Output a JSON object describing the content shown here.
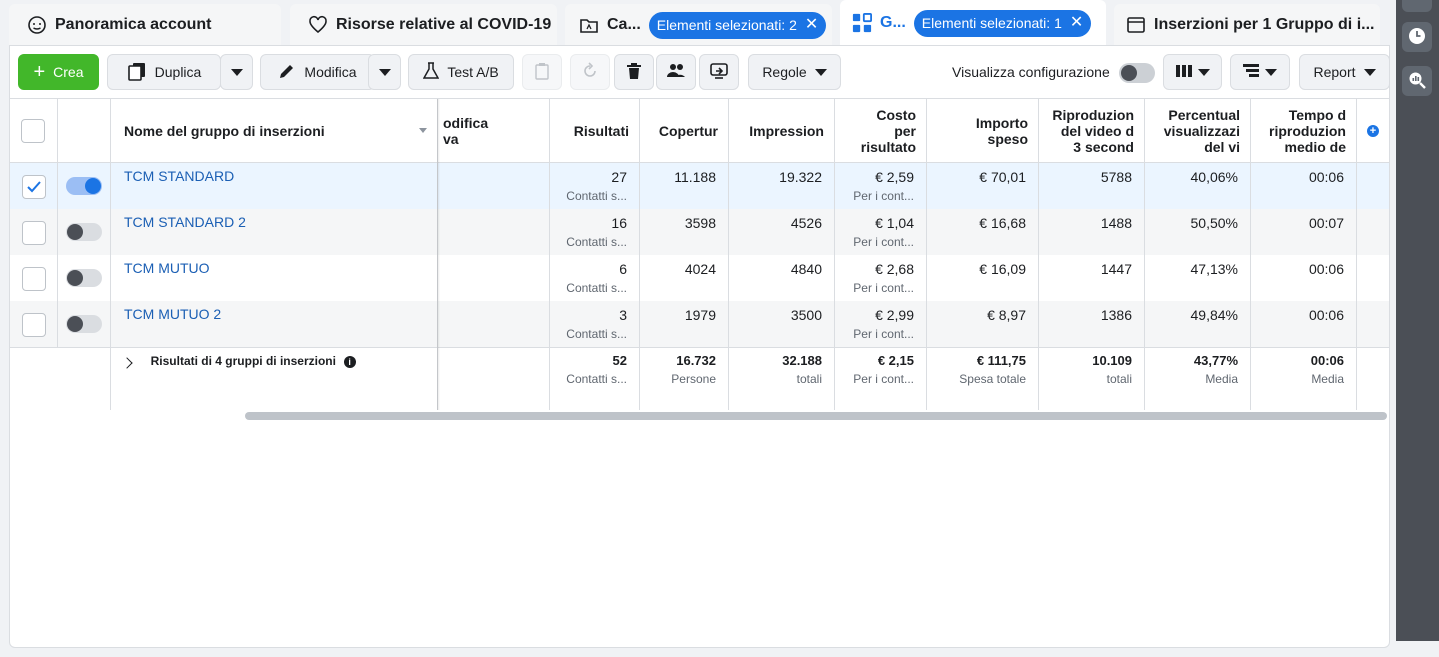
{
  "tabs": [
    {
      "label": "Panoramica account",
      "icon": "gauge-icon"
    },
    {
      "label": "Risorse relative al COVID-19",
      "icon": "heart-icon"
    },
    {
      "label": "Ca...",
      "icon": "folder-icon",
      "pill": "Elementi selezionati: 2"
    },
    {
      "label": "G...",
      "icon": "grid-icon",
      "pill": "Elementi selezionati: 1"
    },
    {
      "label": "Inserzioni per 1 Gruppo di i...",
      "icon": "window-icon"
    }
  ],
  "toolbar": {
    "create_label": "Crea",
    "duplicate_label": "Duplica",
    "edit_label": "Modifica",
    "abtest_label": "Test A/B",
    "rules_label": "Regole",
    "config_label": "Visualizza configurazione",
    "report_label": "Report"
  },
  "table": {
    "headers": {
      "name": "Nome del gruppo di inserzioni",
      "modifica": "odifica\nva",
      "results": "Risultati",
      "reach": "Copertur",
      "impressions": "Impression",
      "cost": "Costo\nper\nrisultato",
      "spent": "Importo\nspeso",
      "video": "Riproduzion\ndel video d\n3 second",
      "percent": "Percentual\nvisualizzazi\ndel vi",
      "time": "Tempo d\nriproduzion\nmedio de"
    },
    "rows": [
      {
        "name": "TCM STANDARD",
        "results": "27",
        "results_sub": "Contatti s...",
        "reach": "11.188",
        "impressions": "19.322",
        "cost": "€ 2,59",
        "cost_sub": "Per i cont...",
        "spent": "€ 70,01",
        "video": "5788",
        "percent": "40,06%",
        "time": "00:06"
      },
      {
        "name": "TCM STANDARD 2",
        "results": "16",
        "results_sub": "Contatti s...",
        "reach": "3598",
        "impressions": "4526",
        "cost": "€ 1,04",
        "cost_sub": "Per i cont...",
        "spent": "€ 16,68",
        "video": "1488",
        "percent": "50,50%",
        "time": "00:07"
      },
      {
        "name": "TCM MUTUO",
        "results": "6",
        "results_sub": "Contatti s...",
        "reach": "4024",
        "impressions": "4840",
        "cost": "€ 2,68",
        "cost_sub": "Per i cont...",
        "spent": "€ 16,09",
        "video": "1447",
        "percent": "47,13%",
        "time": "00:06"
      },
      {
        "name": "TCM MUTUO 2",
        "results": "3",
        "results_sub": "Contatti s...",
        "reach": "1979",
        "impressions": "3500",
        "cost": "€ 2,99",
        "cost_sub": "Per i cont...",
        "spent": "€ 8,97",
        "video": "1386",
        "percent": "49,84%",
        "time": "00:06"
      }
    ],
    "totals": {
      "label": "Risultati di 4 gruppi di inserzioni",
      "results": "52",
      "results_sub": "Contatti s...",
      "reach": "16.732",
      "reach_sub": "Persone",
      "impressions": "32.188",
      "impressions_sub": "totali",
      "cost": "€ 2,15",
      "cost_sub": "Per i cont...",
      "spent": "€ 111,75",
      "spent_sub": "Spesa totale",
      "video": "10.109",
      "video_sub": "totali",
      "percent": "43,77%",
      "percent_sub": "Media",
      "time": "00:06",
      "time_sub": "Media"
    }
  },
  "colors": {
    "accent": "#1b74e4",
    "create": "#42b72a",
    "link": "#1b5fb4"
  }
}
